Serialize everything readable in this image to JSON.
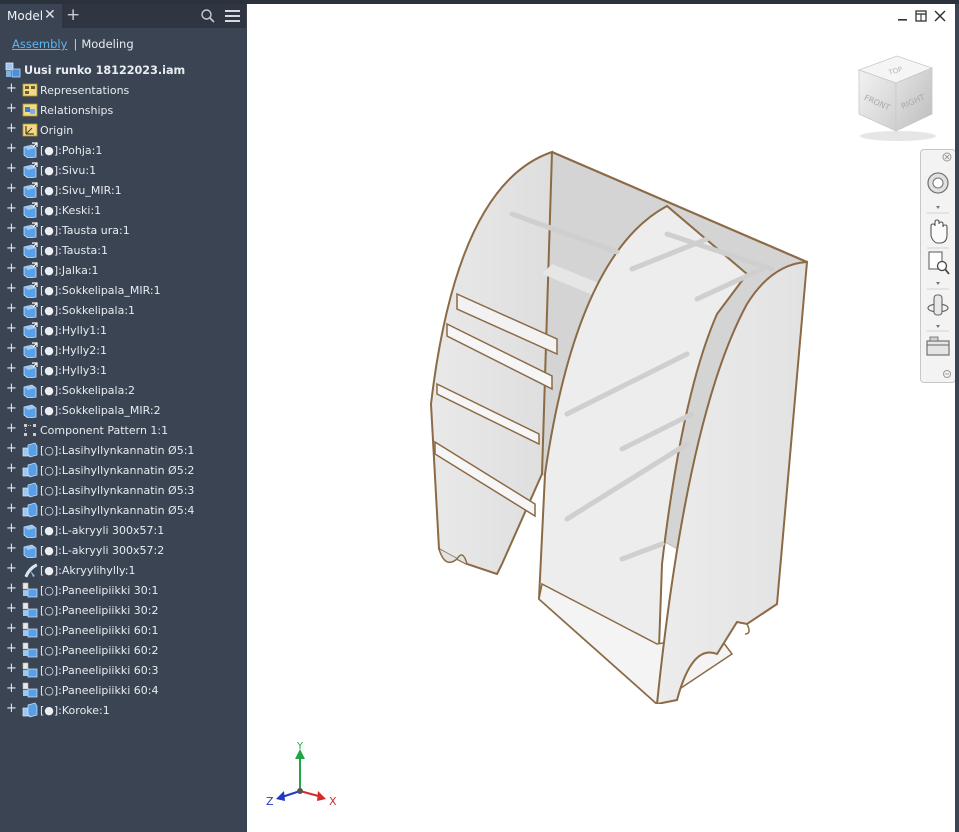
{
  "panel": {
    "tab_label": "Model",
    "modes": {
      "assembly": "Assembly",
      "modeling": "Modeling"
    }
  },
  "tree": {
    "root": "Uusi runko 18122023.iam",
    "items": [
      {
        "label": "Representations",
        "icon": "representations-icon"
      },
      {
        "label": "Relationships",
        "icon": "relationships-icon"
      },
      {
        "label": "Origin",
        "icon": "origin-icon"
      },
      {
        "label": "[●]:Pohja:1",
        "icon": "part-adaptive-icon"
      },
      {
        "label": "[●]:Sivu:1",
        "icon": "part-adaptive-icon"
      },
      {
        "label": "[●]:Sivu_MIR:1",
        "icon": "part-adaptive-icon"
      },
      {
        "label": "[●]:Keski:1",
        "icon": "part-adaptive-icon"
      },
      {
        "label": "[●]:Tausta ura:1",
        "icon": "part-adaptive-icon"
      },
      {
        "label": "[●]:Tausta:1",
        "icon": "part-adaptive-icon"
      },
      {
        "label": "[●]:Jalka:1",
        "icon": "part-adaptive-icon"
      },
      {
        "label": "[●]:Sokkelipala_MIR:1",
        "icon": "part-adaptive-icon"
      },
      {
        "label": "[●]:Sokkelipala:1",
        "icon": "part-adaptive-icon"
      },
      {
        "label": "[●]:Hylly1:1",
        "icon": "part-adaptive-icon"
      },
      {
        "label": "[●]:Hylly2:1",
        "icon": "part-adaptive-icon"
      },
      {
        "label": "[●]:Hylly3:1",
        "icon": "part-adaptive-icon"
      },
      {
        "label": "[●]:Sokkelipala:2",
        "icon": "part-icon"
      },
      {
        "label": "[●]:Sokkelipala_MIR:2",
        "icon": "part-icon"
      },
      {
        "label": "Component Pattern 1:1",
        "icon": "pattern-icon"
      },
      {
        "label": "[○]:Lasihyllynkannatin Ø5:1",
        "icon": "subassembly-icon"
      },
      {
        "label": "[○]:Lasihyllynkannatin Ø5:2",
        "icon": "subassembly-icon"
      },
      {
        "label": "[○]:Lasihyllynkannatin Ø5:3",
        "icon": "subassembly-icon"
      },
      {
        "label": "[○]:Lasihyllynkannatin Ø5:4",
        "icon": "subassembly-icon"
      },
      {
        "label": "[●]:L-akryyli 300x57:1",
        "icon": "part-icon"
      },
      {
        "label": "[●]:L-akryyli 300x57:2",
        "icon": "part-icon"
      },
      {
        "label": "[●]:Akryylihylly:1",
        "icon": "sheet-part-icon"
      },
      {
        "label": "[○]:Paneelipiikki 30:1",
        "icon": "paneelipiikki-icon"
      },
      {
        "label": "[○]:Paneelipiikki 30:2",
        "icon": "paneelipiikki-icon"
      },
      {
        "label": "[○]:Paneelipiikki 60:1",
        "icon": "paneelipiikki-icon"
      },
      {
        "label": "[○]:Paneelipiikki 60:2",
        "icon": "paneelipiikki-icon"
      },
      {
        "label": "[○]:Paneelipiikki 60:3",
        "icon": "paneelipiikki-icon"
      },
      {
        "label": "[○]:Paneelipiikki 60:4",
        "icon": "paneelipiikki-icon"
      },
      {
        "label": "[●]:Koroke:1",
        "icon": "subassembly-icon"
      }
    ]
  },
  "viewcube": {
    "top": "TOP",
    "front": "FRONT",
    "right": "RIGHT"
  },
  "triad": {
    "x": "X",
    "y": "Y",
    "z": "Z"
  },
  "colors": {
    "panel_bg": "#3b4453",
    "tab_bar_bg": "#2f3641",
    "accent": "#5eb6f0",
    "part_edge": "#8b6a45",
    "axis_x": "#d62b2b",
    "axis_y": "#22a645",
    "axis_z": "#2338c9"
  }
}
